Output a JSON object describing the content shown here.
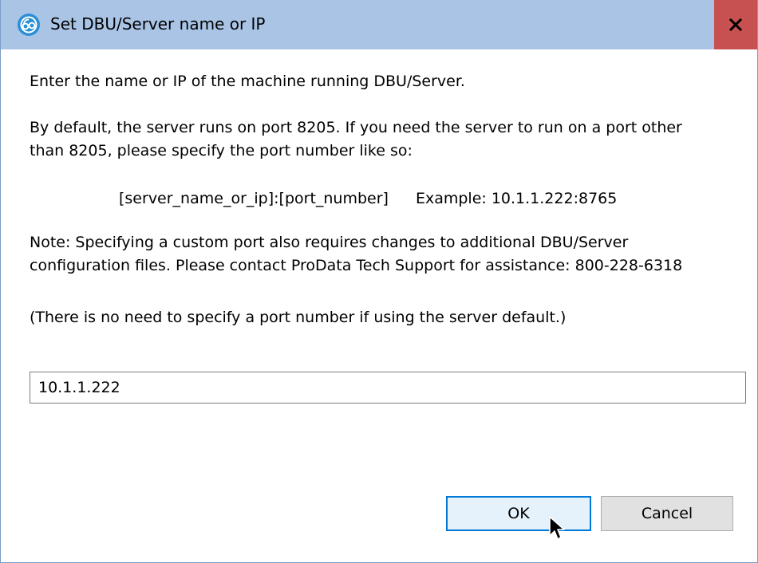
{
  "window": {
    "title": "Set DBU/Server name or IP",
    "app_icon": "prodata-logo-icon",
    "close_icon": "close-icon",
    "colors": {
      "titlebar": "#a9c4e5",
      "close_button": "#c75050",
      "ok_border": "#0078d7"
    }
  },
  "body": {
    "intro": "Enter the name or IP of the machine running DBU/Server.",
    "default_port_line1": "By default, the server runs on port 8205. If you need the server to run on a port other",
    "default_port_line2": "than 8205, please specify the port number like so:",
    "format": "[server_name_or_ip]:[port_number]",
    "example": "Example: 10.1.1.222:8765",
    "note_line1": "Note: Specifying a custom port also requires changes to additional DBU/Server",
    "note_line2": "configuration files. Please contact ProData Tech Support for assistance: 800-228-6318",
    "default_hint": "(There is no need to specify a port number if using the server default.)"
  },
  "server_input": {
    "value": "10.1.1.222"
  },
  "buttons": {
    "ok_label": "OK",
    "cancel_label": "Cancel"
  },
  "cursor": "mouse-pointer-icon"
}
